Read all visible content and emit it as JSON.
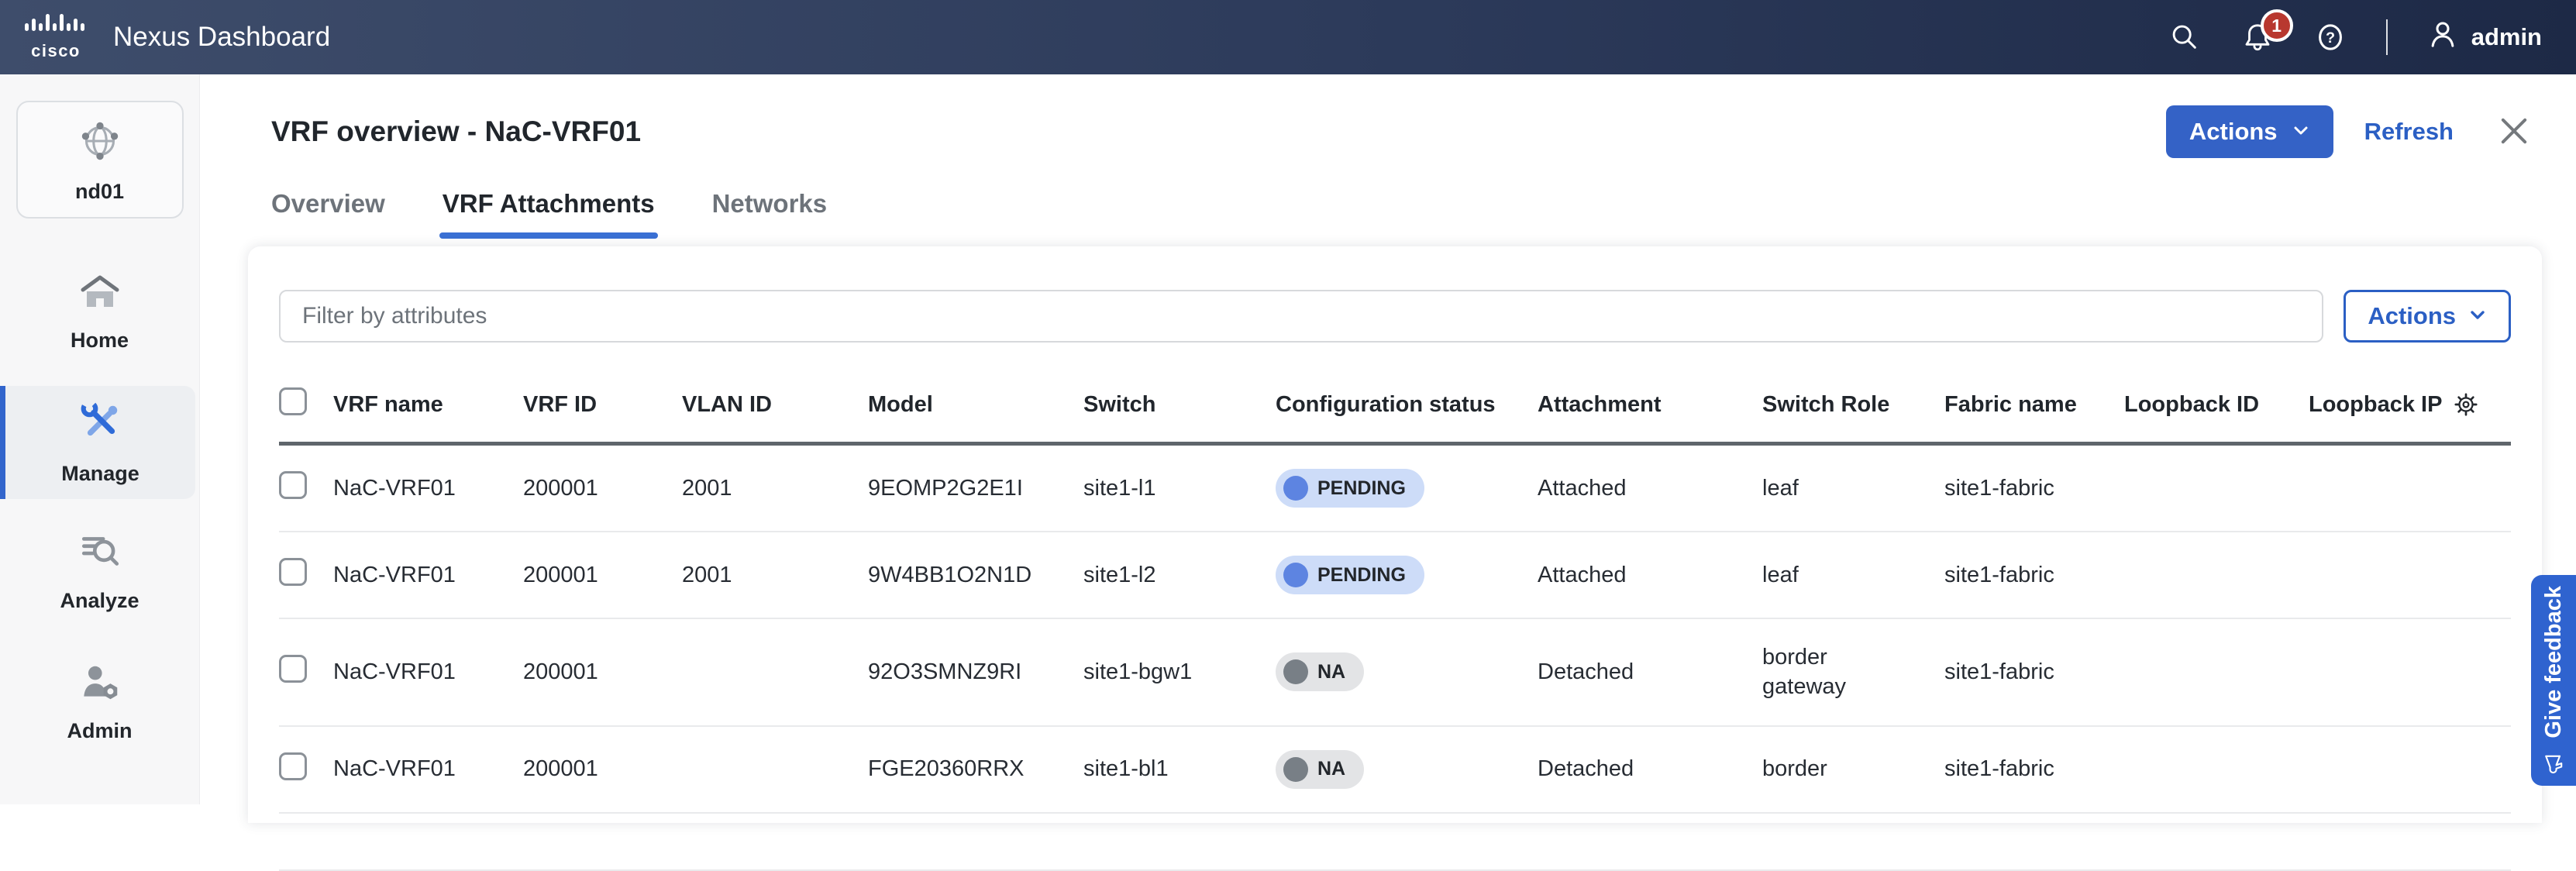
{
  "header": {
    "brand": "cisco",
    "app_title": "Nexus Dashboard",
    "notification_count": "1",
    "user_name": "admin"
  },
  "sidebar": {
    "cluster_label": "nd01",
    "items": [
      {
        "label": "Home"
      },
      {
        "label": "Manage"
      },
      {
        "label": "Analyze"
      },
      {
        "label": "Admin"
      }
    ]
  },
  "page": {
    "title": "VRF overview - NaC-VRF01",
    "actions_button": "Actions",
    "refresh_link": "Refresh",
    "tabs": [
      {
        "label": "Overview"
      },
      {
        "label": "VRF Attachments"
      },
      {
        "label": "Networks"
      }
    ]
  },
  "toolbar": {
    "filter_placeholder": "Filter by attributes",
    "actions_button": "Actions"
  },
  "table": {
    "columns": [
      "VRF name",
      "VRF ID",
      "VLAN ID",
      "Model",
      "Switch",
      "Configuration status",
      "Attachment",
      "Switch Role",
      "Fabric name",
      "Loopback ID",
      "Loopback IP"
    ],
    "rows": [
      {
        "vrf_name": "NaC-VRF01",
        "vrf_id": "200001",
        "vlan_id": "2001",
        "model": "9EOMP2G2E1I",
        "switch": "site1-l1",
        "status": "PENDING",
        "attachment": "Attached",
        "switch_role": "leaf",
        "fabric_name": "site1-fabric",
        "loopback_id": "",
        "loopback_ip": ""
      },
      {
        "vrf_name": "NaC-VRF01",
        "vrf_id": "200001",
        "vlan_id": "2001",
        "model": "9W4BB1O2N1D",
        "switch": "site1-l2",
        "status": "PENDING",
        "attachment": "Attached",
        "switch_role": "leaf",
        "fabric_name": "site1-fabric",
        "loopback_id": "",
        "loopback_ip": ""
      },
      {
        "vrf_name": "NaC-VRF01",
        "vrf_id": "200001",
        "vlan_id": "",
        "model": "92O3SMNZ9RI",
        "switch": "site1-bgw1",
        "status": "NA",
        "attachment": "Detached",
        "switch_role": "border gateway",
        "fabric_name": "site1-fabric",
        "loopback_id": "",
        "loopback_ip": ""
      },
      {
        "vrf_name": "NaC-VRF01",
        "vrf_id": "200001",
        "vlan_id": "",
        "model": "FGE20360RRX",
        "switch": "site1-bl1",
        "status": "NA",
        "attachment": "Detached",
        "switch_role": "border",
        "fabric_name": "site1-fabric",
        "loopback_id": "",
        "loopback_ip": ""
      }
    ]
  },
  "feedback_button": "Give feedback",
  "colors": {
    "header_gradient_start": "#3e4d6b",
    "header_gradient_end": "#1d2946",
    "accent_blue": "#2b5fc4",
    "primary_button": "#3462c6",
    "tab_underline": "#3a70d4",
    "pending_badge_bg": "#cddcf8",
    "pending_dot": "#5d84e1",
    "na_badge_bg": "#e3e4e6",
    "na_dot": "#787f86",
    "notification_red": "#b8382f",
    "feedback_bg": "#2f63cf"
  }
}
